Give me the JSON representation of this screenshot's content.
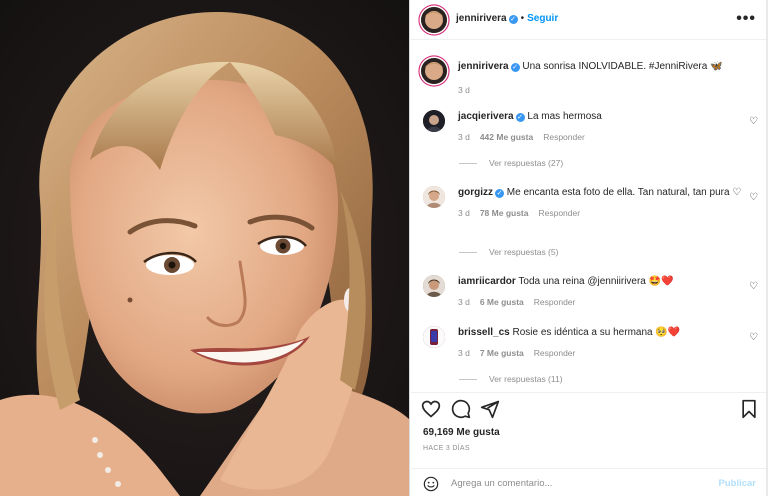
{
  "header": {
    "username": "jennirivera",
    "verified_mark": "✓",
    "separator": "•",
    "follow_label": "Seguir",
    "more_label": "•••"
  },
  "caption": {
    "username": "jennirivera",
    "text": "Una sonrisa INOLVIDABLE. #JenniRivera 🦋",
    "time": "3 d"
  },
  "comments": [
    {
      "username": "jacqierivera",
      "verified": true,
      "text": "La mas hermosa",
      "time": "3 d",
      "likes": "442 Me gusta",
      "reply": "Responder",
      "view_replies": "Ver respuestas (27)",
      "avatar_color": "#2b2b33"
    },
    {
      "username": "gorgizz",
      "verified": true,
      "text": "Me encanta esta foto de ella. Tan natural, tan pura ♡",
      "time": "3 d",
      "likes": "78 Me gusta",
      "reply": "Responder",
      "view_replies": "Ver respuestas (5)",
      "avatar_color": "#b08a74"
    },
    {
      "username": "iamriicardor",
      "verified": false,
      "text": "Toda una reina @jenniirivera 🤩❤️",
      "time": "3 d",
      "likes": "6 Me gusta",
      "reply": "Responder",
      "avatar_color": "#6b5a4a"
    },
    {
      "username": "brissell_cs",
      "verified": false,
      "text": "Rosie es idéntica a su hermana 🥺❤️",
      "time": "3 d",
      "likes": "7 Me gusta",
      "reply": "Responder",
      "view_replies": "Ver respuestas (11)",
      "avatar_color": "#7a1f3a"
    }
  ],
  "actions": {
    "likes_count": "69,169 Me gusta",
    "date": "HACE 3 DÍAS"
  },
  "add_comment": {
    "emoji_icon": "smiley-icon",
    "placeholder": "Agrega un comentario...",
    "publish_label": "Publicar"
  },
  "colors": {
    "accent": "#0095f6",
    "verified": "#3897f0",
    "muted": "#8e8e8e",
    "text": "#262626",
    "publish_disabled": "#b2dffc"
  },
  "icons": [
    "heart-icon",
    "comment-icon",
    "share-icon",
    "bookmark-icon",
    "more-options-icon",
    "verified-icon",
    "smiley-icon"
  ]
}
